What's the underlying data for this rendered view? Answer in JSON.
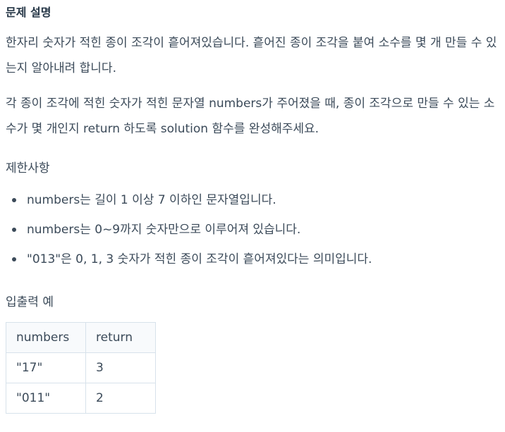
{
  "title": "문제 설명",
  "paragraphs": [
    "한자리 숫자가 적힌 종이 조각이 흩어져있습니다. 흩어진 종이 조각을 붙여 소수를 몇 개 만들 수 있는지 알아내려 합니다.",
    "각 종이 조각에 적힌 숫자가 적힌 문자열 numbers가 주어졌을 때, 종이 조각으로 만들 수 있는 소수가 몇 개인지 return 하도록 solution 함수를 완성해주세요."
  ],
  "constraints": {
    "heading": "제한사항",
    "items": [
      "numbers는 길이 1 이상 7 이하인 문자열입니다.",
      "numbers는 0~9까지 숫자만으로 이루어져 있습니다.",
      "\"013\"은 0, 1, 3 숫자가 적힌 종이 조각이 흩어져있다는 의미입니다."
    ]
  },
  "examples": {
    "heading": "입출력 예",
    "columns": [
      "numbers",
      "return"
    ],
    "rows": [
      [
        "\"17\"",
        "3"
      ],
      [
        "\"011\"",
        "2"
      ]
    ]
  }
}
